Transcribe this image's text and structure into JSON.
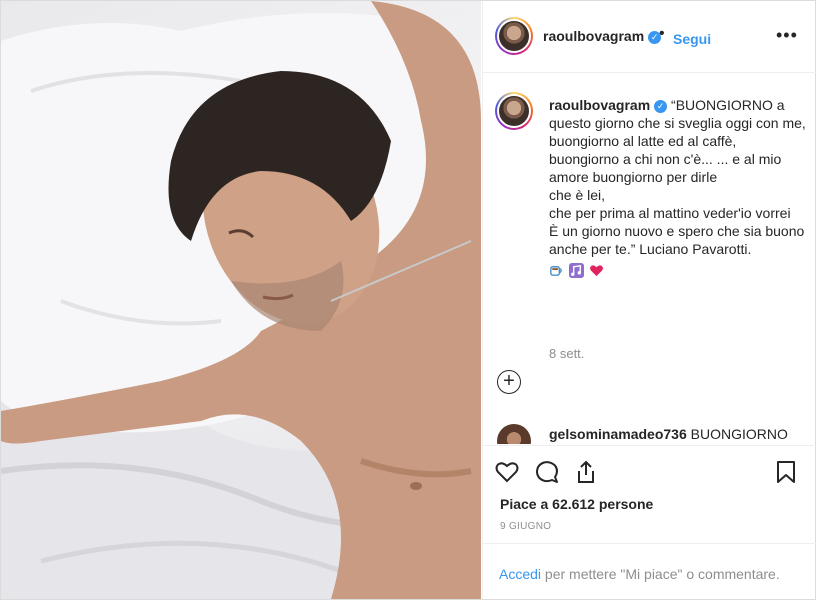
{
  "header": {
    "username": "raoulbovagram",
    "verified_icon": "verified-badge-icon",
    "separator": "•",
    "follow_label": "Segui",
    "more_label": "•••"
  },
  "caption": {
    "username": "raoulbovagram",
    "lines": [
      "“BUONGIORNO a questo giorno che si sveglia oggi con me,",
      "buongiorno al latte ed al caffè,",
      "buongiorno a chi non c'è... ... e al mio amore buongiorno per dirle",
      "che è lei,",
      "che per prima al mattino veder'io vorrei",
      "È un giorno nuovo e spero che sia buono",
      "anche per te.” Luciano Pavarotti."
    ],
    "emojis": [
      "coffee-cup-emoji",
      "music-notes-emoji",
      "red-heart-emoji"
    ],
    "age": "8 sett."
  },
  "load_more_label": "+",
  "comment": {
    "username": "gelsominamadeo736",
    "text": "BUONGIORNO"
  },
  "actions": {
    "icons": [
      "heart-icon",
      "comment-icon",
      "share-icon",
      "bookmark-icon"
    ],
    "likes_text": "Piace a 62.612 persone",
    "date": "9 GIUGNO"
  },
  "login": {
    "link": "Accedi",
    "text": " per mettere \"Mi piace\" o commentare."
  },
  "colors": {
    "accent": "#3897f0",
    "text": "#262626",
    "muted": "#8e8e8e",
    "border": "#efefef",
    "heart": "#ed4956"
  }
}
